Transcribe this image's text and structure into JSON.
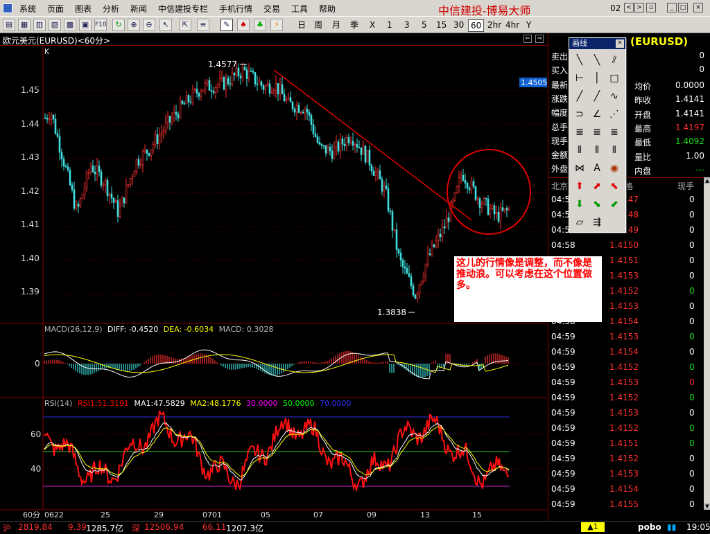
{
  "menu": {
    "items": [
      "系统",
      "页面",
      "图表",
      "分析",
      "新闻",
      "中信建投专栏",
      "手机行情",
      "交易",
      "工具",
      "帮助"
    ],
    "brand": "中信建投-博易大师",
    "window_number": "02"
  },
  "toolbar": {
    "periods": [
      "日",
      "周",
      "月",
      "季",
      "X",
      "1",
      "3",
      "5",
      "15",
      "30",
      "60",
      "2hr",
      "4hr",
      "Y"
    ],
    "active_period": "60"
  },
  "chart": {
    "title": "欧元美元(EURUSD)<60分>",
    "price_label_k": "K",
    "current_price_tag": "1.4505",
    "price_ticks": [
      "1.45",
      "1.44",
      "1.43",
      "1.42",
      "1.41",
      "1.40",
      "1.39"
    ],
    "high_label": "1.4577",
    "low_label": "1.3838",
    "macd_header": {
      "name": "MACD(26,12,9)",
      "diff": "DIFF: -0.4520",
      "dea": "DEA: -0.6034",
      "macd": "MACD: 0.3028"
    },
    "macd_zero": "0",
    "rsi_header": {
      "name": "RSI(14)",
      "rsi1": "RSI1:51.3191",
      "ma1": "MA1:47.5829",
      "ma2": "MA2:48.1776",
      "l30": "30.0000",
      "l50": "50.0000",
      "l70": "70.0000"
    },
    "rsi_ticks": [
      "60",
      "40"
    ],
    "date_axis": [
      "60分",
      "0622",
      "25",
      "29",
      "0701",
      "05",
      "07",
      "09",
      "13",
      "15"
    ]
  },
  "chart_data": {
    "type": "line",
    "title": "欧元美元(EURUSD)<60分>",
    "high": 1.4577,
    "low": 1.3838,
    "current": 1.4505,
    "ylim": [
      1.383,
      1.46
    ],
    "x": [
      "0622",
      "25",
      "29",
      "0701",
      "05",
      "07",
      "09",
      "13",
      "15"
    ],
    "series": [
      {
        "name": "K",
        "values": [
          1.442,
          1.414,
          1.428,
          1.45,
          1.456,
          1.444,
          1.435,
          1.395,
          1.424
        ]
      }
    ]
  },
  "note": {
    "text": "这儿的行情像是调整，而不像是推动浪。可以考虑在这个位置做多。"
  },
  "quote_panel": {
    "symbol": "(EURUSD)",
    "left_rows": [
      {
        "label": "卖出",
        "value": "0"
      },
      {
        "label": "买入",
        "value": "0"
      },
      {
        "label": "最新",
        "value": ""
      },
      {
        "label": "涨跌",
        "value": ""
      },
      {
        "label": "幅度",
        "value": ""
      },
      {
        "label": "总手",
        "value": ""
      },
      {
        "label": "现手",
        "value": ""
      },
      {
        "label": "金额",
        "value": ""
      },
      {
        "label": "外盘",
        "value": ""
      }
    ],
    "right_rows": [
      {
        "label": "均价",
        "value": "0.0000",
        "color": "#ffffff"
      },
      {
        "label": "昨收",
        "value": "1.4141",
        "color": "#ffffff"
      },
      {
        "label": "开盘",
        "value": "1.4141",
        "color": "#ffffff"
      },
      {
        "label": "最高",
        "value": "1.4197",
        "color": "#ff3030"
      },
      {
        "label": "最低",
        "value": "1.4092",
        "color": "#20e020"
      },
      {
        "label": "量比",
        "value": "1.00",
        "color": "#ffffff"
      },
      {
        "label": "内盘",
        "value": "---",
        "color": "#20e020"
      }
    ],
    "ticks_header": {
      "time": "北京",
      "price": "格",
      "vol": "现手"
    },
    "ticks": [
      {
        "time": "04:57",
        "price": "1.4147",
        "vol": "0",
        "vc": "#ffffff"
      },
      {
        "time": "04:57",
        "price": "1.4148",
        "vol": "0",
        "vc": "#ffffff"
      },
      {
        "time": "04:57",
        "price": "1.4149",
        "vol": "0",
        "vc": "#ffffff"
      },
      {
        "time": "04:58",
        "price": "1.4150",
        "vol": "0",
        "vc": "#ffffff"
      },
      {
        "time": "04:58",
        "price": "1.4151",
        "vol": "0",
        "vc": "#ffffff"
      },
      {
        "time": "04:58",
        "price": "1.4153",
        "vol": "0",
        "vc": "#ffffff"
      },
      {
        "time": "04:58",
        "price": "1.4152",
        "vol": "0",
        "vc": "#20e020"
      },
      {
        "time": "04:58",
        "price": "1.4153",
        "vol": "0",
        "vc": "#ffffff"
      },
      {
        "time": "04:58",
        "price": "1.4154",
        "vol": "0",
        "vc": "#ffffff"
      },
      {
        "time": "04:59",
        "price": "1.4153",
        "vol": "0",
        "vc": "#20e020"
      },
      {
        "time": "04:59",
        "price": "1.4154",
        "vol": "0",
        "vc": "#ffffff"
      },
      {
        "time": "04:59",
        "price": "1.4152",
        "vol": "0",
        "vc": "#20e020"
      },
      {
        "time": "04:59",
        "price": "1.4153",
        "vol": "0",
        "vc": "#ff3030"
      },
      {
        "time": "04:59",
        "price": "1.4152",
        "vol": "0",
        "vc": "#20e020"
      },
      {
        "time": "04:59",
        "price": "1.4153",
        "vol": "0",
        "vc": "#ffffff"
      },
      {
        "time": "04:59",
        "price": "1.4152",
        "vol": "0",
        "vc": "#20e020"
      },
      {
        "time": "04:59",
        "price": "1.4151",
        "vol": "0",
        "vc": "#20e020"
      },
      {
        "time": "04:59",
        "price": "1.4152",
        "vol": "0",
        "vc": "#ffffff"
      },
      {
        "time": "04:59",
        "price": "1.4153",
        "vol": "0",
        "vc": "#ffffff"
      },
      {
        "time": "04:59",
        "price": "1.4154",
        "vol": "0",
        "vc": "#ffffff"
      },
      {
        "time": "04:59",
        "price": "1.4155",
        "vol": "0",
        "vc": "#ffffff"
      }
    ]
  },
  "palette": {
    "title": "画线"
  },
  "status": {
    "sh_label": "沪",
    "sh_index": "2819.84",
    "sh_change": "9.39",
    "sh_amount": "1285.7亿",
    "sz_label": "深",
    "sz_index": "12506.94",
    "sz_change": "66.11",
    "sz_amount": "1207.3亿",
    "alert": "▲1",
    "pobo": "pobo",
    "time": "19:05"
  }
}
